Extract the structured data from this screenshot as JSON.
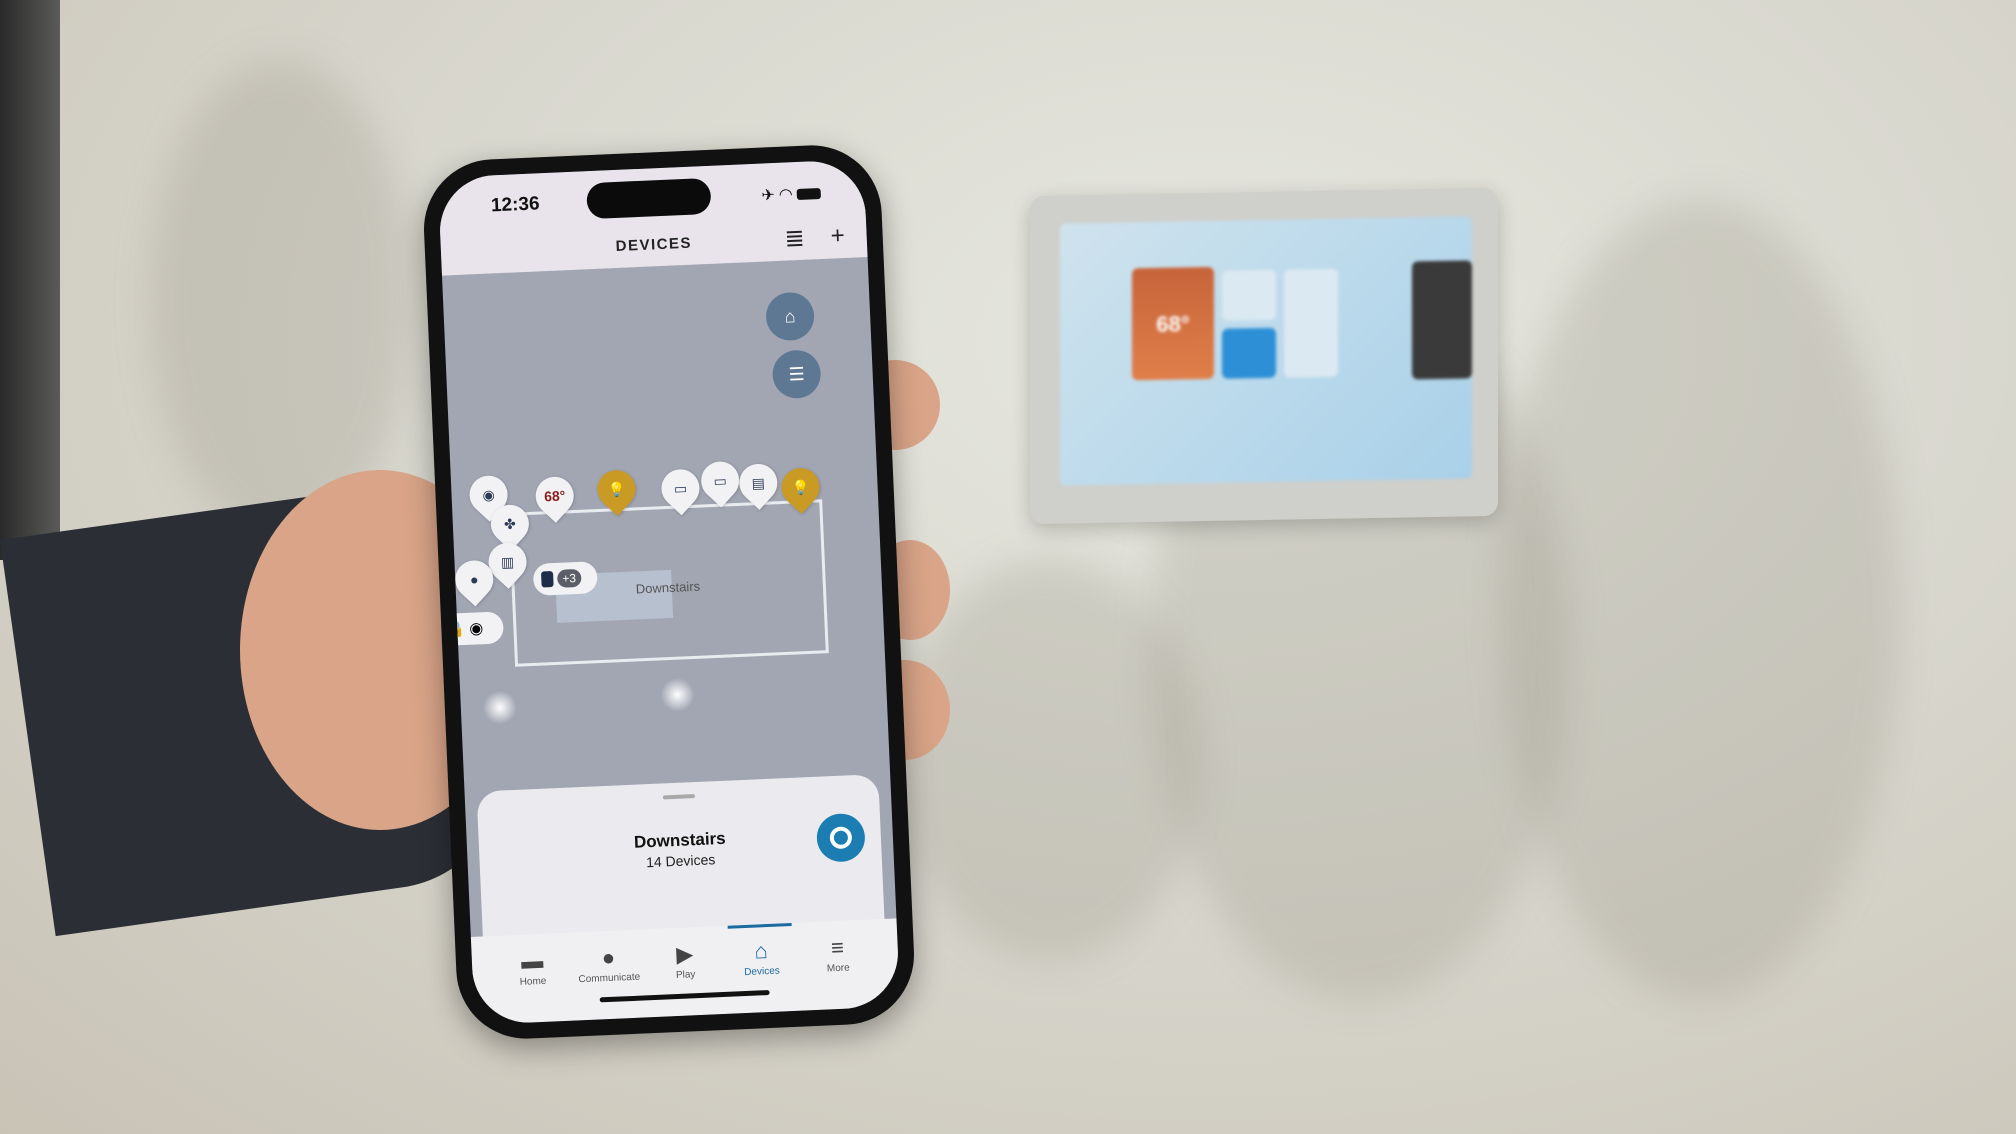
{
  "status_bar": {
    "time": "12:36"
  },
  "header": {
    "title": "DEVICES",
    "list_icon": "list-icon",
    "add_icon": "plus-icon"
  },
  "map": {
    "buttons": [
      {
        "name": "home-location-button",
        "icon": "house-arrow-icon"
      },
      {
        "name": "filter-button",
        "icon": "sliders-icon"
      }
    ],
    "pins": [
      {
        "icon": "camera-icon",
        "label": "◉"
      },
      {
        "icon": "thermostat",
        "label": "68°"
      },
      {
        "icon": "bulb-on-icon",
        "label": "💡",
        "active": true
      },
      {
        "icon": "tv-icon",
        "label": "▭"
      },
      {
        "icon": "tv-icon",
        "label": "▭"
      },
      {
        "icon": "air-purifier-icon",
        "label": "▤"
      },
      {
        "icon": "bulb-on-icon",
        "label": "💡",
        "active": true
      },
      {
        "icon": "fan-icon",
        "label": "✤"
      },
      {
        "icon": "blinds-icon",
        "label": "▥"
      },
      {
        "icon": "bulb-icon",
        "label": "●"
      }
    ],
    "group_chip": {
      "icon": "speaker-icon",
      "count": "+3"
    },
    "extra_chip": {
      "icons": [
        "lock-icon",
        "camera-icon"
      ]
    },
    "room_label": "Downstairs",
    "active_color": "#c99a24"
  },
  "sheet": {
    "title": "Downstairs",
    "subtitle": "14 Devices",
    "alexa_color": "#1b7db2"
  },
  "tabs": [
    {
      "label": "Home",
      "icon": "home-icon"
    },
    {
      "label": "Communicate",
      "icon": "chat-icon"
    },
    {
      "label": "Play",
      "icon": "play-icon"
    },
    {
      "label": "Devices",
      "icon": "devices-icon",
      "active": true
    },
    {
      "label": "More",
      "icon": "menu-icon"
    }
  ],
  "tablet": {
    "temperature": "68°"
  }
}
